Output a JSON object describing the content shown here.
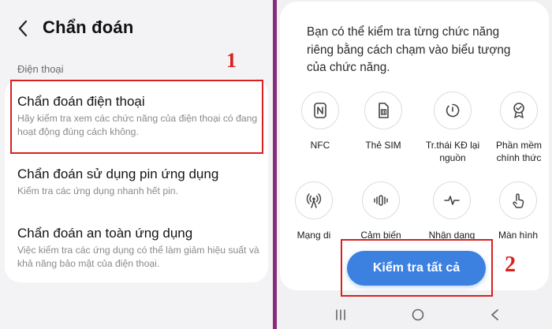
{
  "left": {
    "title": "Chẩn đoán",
    "section_label": "Điện thoại",
    "items": [
      {
        "title": "Chẩn đoán điện thoại",
        "desc": "Hãy kiểm tra xem các chức năng của điện thoại có đang hoạt động đúng cách không."
      },
      {
        "title": "Chẩn đoán sử dụng pin ứng dụng",
        "desc": "Kiểm tra các ứng dụng nhanh hết pin."
      },
      {
        "title": "Chẩn đoán an toàn ứng dụng",
        "desc": "Việc kiểm tra các ứng dụng có thể làm giảm hiệu suất và khả năng bảo mật của điện thoại."
      }
    ]
  },
  "annotations": {
    "marker_1": "1",
    "marker_2": "2"
  },
  "right": {
    "intro": "Bạn có thể kiểm tra từng chức năng riêng bằng cách chạm vào biểu tượng của chức năng.",
    "features": [
      {
        "label": "NFC",
        "icon": "nfc-icon"
      },
      {
        "label": "Thẻ SIM",
        "icon": "sim-card-icon"
      },
      {
        "label": "Tr.thái KĐ lại nguồn",
        "icon": "power-restart-icon"
      },
      {
        "label": "Phần mềm chính thức",
        "icon": "certified-badge-icon"
      },
      {
        "label": "Mạng di",
        "icon": "mobile-network-icon"
      },
      {
        "label": "Cảm biến",
        "icon": "sensor-icon"
      },
      {
        "label": "Nhận dạng",
        "icon": "pulse-icon"
      },
      {
        "label": "Màn hình",
        "icon": "touch-icon"
      }
    ],
    "check_all_label": "Kiểm tra tất cả"
  },
  "colors": {
    "highlight": "#d82020",
    "accent": "#3c80e0",
    "divider": "#8a2a7c"
  }
}
